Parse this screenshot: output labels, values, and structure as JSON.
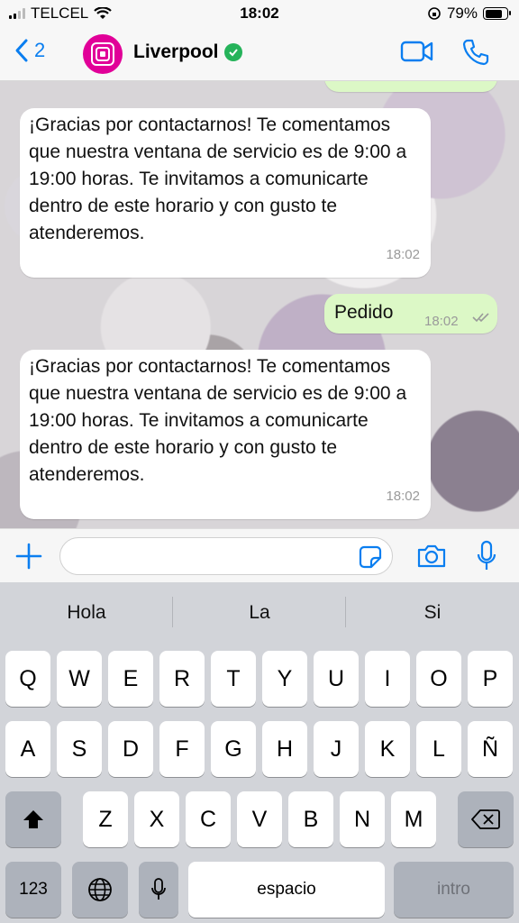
{
  "status_bar": {
    "carrier": "TELCEL",
    "time": "18:02",
    "battery": "79%"
  },
  "header": {
    "back_count": "2",
    "contact_name": "Liverpool",
    "verified": true
  },
  "messages": [
    {
      "direction": "in",
      "text": "¡Gracias por contactarnos!  Te comentamos que nuestra ventana de servicio es de 9:00 a 19:00 horas. Te invitamos a comunicarte dentro de este horario y con gusto te atenderemos.",
      "time": "18:02"
    },
    {
      "direction": "out",
      "text": "Pedido",
      "time": "18:02",
      "status": "delivered"
    },
    {
      "direction": "in",
      "text": "¡Gracias por contactarnos!  Te comentamos que nuestra ventana de servicio es de 9:00 a 19:00 horas. Te invitamos a comunicarte dentro de este horario y con gusto te atenderemos.",
      "time": "18:02"
    }
  ],
  "input": {
    "placeholder": "",
    "value": ""
  },
  "keyboard": {
    "suggestions": [
      "Hola",
      "La",
      "Si"
    ],
    "row1": [
      "Q",
      "W",
      "E",
      "R",
      "T",
      "Y",
      "U",
      "I",
      "O",
      "P"
    ],
    "row2": [
      "A",
      "S",
      "D",
      "F",
      "G",
      "H",
      "J",
      "K",
      "L",
      "Ñ"
    ],
    "row3": [
      "Z",
      "X",
      "C",
      "V",
      "B",
      "N",
      "M"
    ],
    "numbers_label": "123",
    "space_label": "espacio",
    "return_label": "intro"
  },
  "colors": {
    "accent": "#0a7ef0",
    "bubble_out": "#dcf8c6",
    "brand": "#e10098",
    "verified": "#25b35a"
  },
  "icons": [
    "back-chevron-icon",
    "liverpool-logo-icon",
    "verified-icon",
    "video-call-icon",
    "phone-call-icon",
    "plus-icon",
    "sticker-icon",
    "camera-icon",
    "microphone-icon",
    "shift-icon",
    "backspace-icon",
    "globe-icon",
    "dictation-icon"
  ]
}
